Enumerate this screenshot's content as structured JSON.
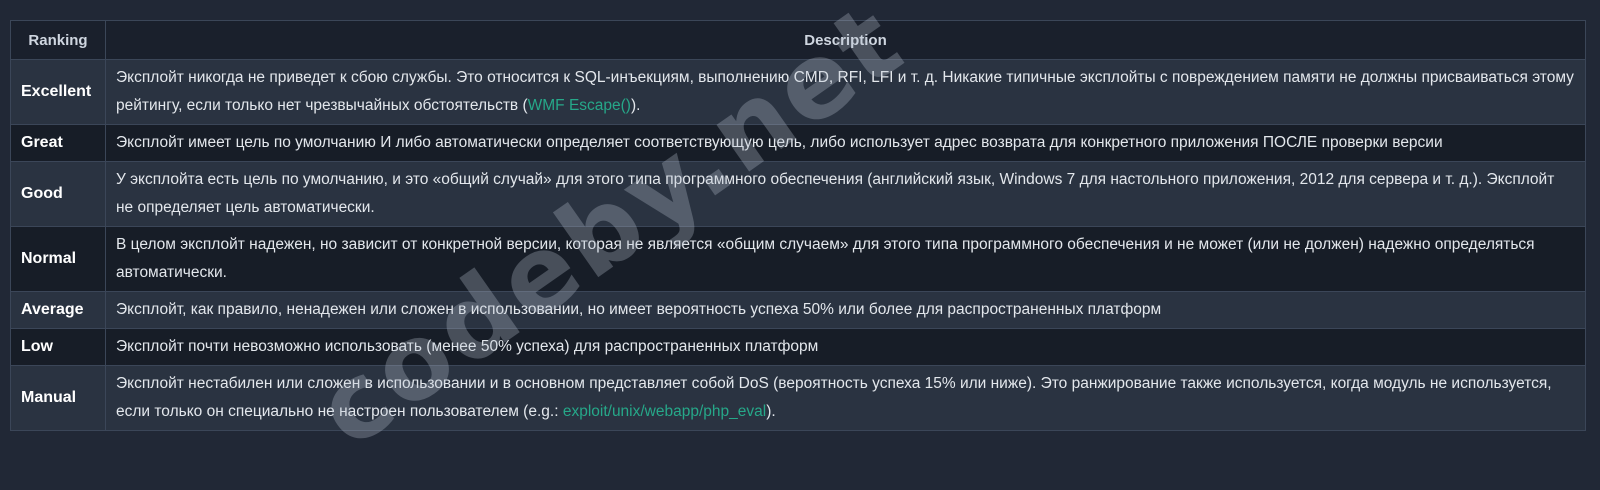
{
  "table": {
    "header": {
      "ranking": "Ranking",
      "description": "Description"
    },
    "rows": [
      {
        "rank": "Excellent",
        "before": "Эксплойт никогда не приведет к сбою службы. Это относится к SQL-инъекциям, выполнению CMD, RFI, LFI и т. д. Никакие типичные эксплойты с повреждением памяти не должны присваиваться этому рейтингу, если только нет чрезвычайных обстоятельств (",
        "link": "WMF Escape()",
        "after": ")."
      },
      {
        "rank": "Great",
        "before": "Эксплойт имеет цель по умолчанию И либо автоматически определяет соответствующую цель, либо использует адрес возврата для конкретного приложения ПОСЛЕ проверки версии",
        "link": "",
        "after": ""
      },
      {
        "rank": "Good",
        "before": "У эксплойта есть цель по умолчанию, и это «общий случай» для этого типа программного обеспечения (английский язык, Windows 7 для настольного приложения, 2012 для сервера и т. д.). Эксплойт не определяет цель автоматически.",
        "link": "",
        "after": ""
      },
      {
        "rank": "Normal",
        "before": "В целом эксплойт надежен, но зависит от конкретной версии, которая не является «общим случаем» для этого типа программного обеспечения и не может (или не должен) надежно определяться автоматически.",
        "link": "",
        "after": ""
      },
      {
        "rank": "Average",
        "before": "Эксплойт, как правило, ненадежен или сложен в использовании, но имеет вероятность успеха 50% или более для распространенных платформ",
        "link": "",
        "after": ""
      },
      {
        "rank": "Low",
        "before": "Эксплойт почти невозможно использовать (менее 50% успеха) для распространенных платформ",
        "link": "",
        "after": ""
      },
      {
        "rank": "Manual",
        "before": "Эксплойт нестабилен или сложен в использовании и в основном представляет собой DoS (вероятность успеха 15% или ниже). Это ранжирование также используется, когда модуль не используется, если только он специально не настроен пользователем (e.g.: ",
        "link": "exploit/unix/webapp/php_eval",
        "after": ")."
      }
    ]
  },
  "watermark": "codeby.net",
  "colors": {
    "background": "#212836",
    "row_odd": "#2a3341",
    "row_even": "#171d27",
    "link": "#26a889",
    "border": "#3b4658"
  }
}
